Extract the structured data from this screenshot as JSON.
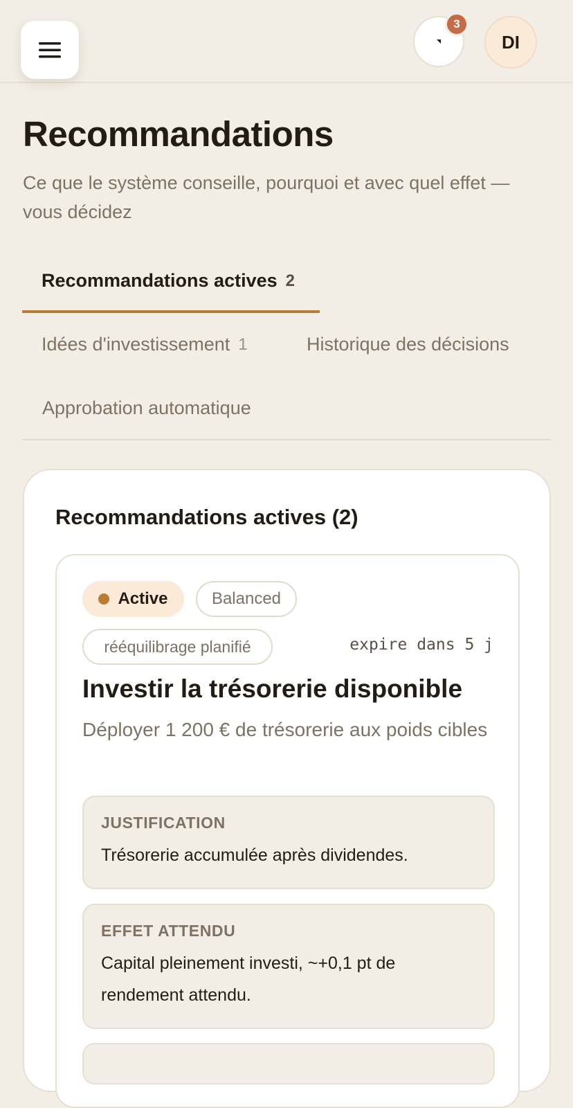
{
  "header": {
    "notification_count": "3",
    "avatar_initials": "DI",
    "icons": {
      "menu": "hamburger-menu-icon",
      "notifications": "progress-ring-icon"
    }
  },
  "page": {
    "title": "Recommandations",
    "subtitle": "Ce que le système conseille, pourquoi et avec quel effet — vous décidez"
  },
  "tabs": [
    {
      "label": "Recommandations actives",
      "count": "2",
      "active": true
    },
    {
      "label": "Idées d'investissement",
      "count": "1",
      "active": false
    },
    {
      "label": "Historique des décisions",
      "count": "",
      "active": false
    },
    {
      "label": "Approbation automatique",
      "count": "",
      "active": false
    }
  ],
  "panel": {
    "title": "Recommandations actives (2)"
  },
  "card": {
    "status": "Active",
    "profile": "Balanced",
    "trigger": "rééquilibrage planifié",
    "expiry": "expire dans 5 j",
    "title": "Investir la trésorerie disponible",
    "description": "Déployer 1 200 € de trésorerie aux poids cibles",
    "justification_label": "JUSTIFICATION",
    "justification_text": "Trésorerie accumulée après dividendes.",
    "effect_label": "EFFET ATTENDU",
    "effect_text": "Capital pleinement investi, ~+0,1 pt de rendement attendu."
  },
  "colors": {
    "background": "#f3eee5",
    "accent": "#b87d33",
    "badge": "#c46b48",
    "status_bg": "#fcead9"
  }
}
